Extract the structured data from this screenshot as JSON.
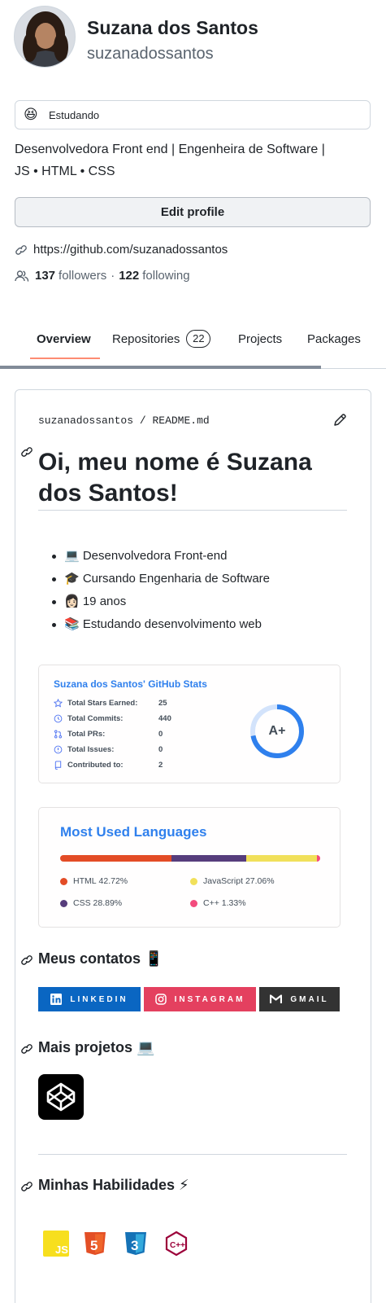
{
  "profile": {
    "name": "Suzana dos Santos",
    "login": "suzanadossantos",
    "status_emoji": "😆",
    "status_text": "Estudando",
    "bio_line1": "Desenvolvedora Front end | Engenheira de Software |",
    "bio_line2": "JS • HTML • CSS",
    "edit_button": "Edit profile",
    "link": "https://github.com/suzanadossantos",
    "followers_count": "137",
    "followers_label": "followers",
    "separator": "·",
    "following_count": "122",
    "following_label": "following"
  },
  "tabs": {
    "overview": "Overview",
    "repositories": "Repositories",
    "repositories_count": "22",
    "projects": "Projects",
    "packages": "Packages"
  },
  "readme": {
    "path_user": "suzanadossantos",
    "path_sep": "/",
    "path_file": "README.md",
    "heading_line1": "Oi, meu nome é Suzana",
    "heading_line2": "dos Santos!",
    "bullets": [
      "💻 Desenvolvedora Front-end",
      "🎓 Cursando Engenharia de Software",
      "👩🏻 19 anos",
      "📚 Estudando desenvolvimento web"
    ],
    "contacts_heading": "Meus contatos 📱",
    "projects_heading": "Mais projetos 💻",
    "skills_heading": "Minhas Habilidades ⚡"
  },
  "stats": {
    "title": "Suzana dos Santos' GitHub Stats",
    "rows": [
      {
        "label": "Total Stars Earned:",
        "value": "25",
        "icon": "star-icon"
      },
      {
        "label": "Total Commits:",
        "value": "440",
        "icon": "history-icon"
      },
      {
        "label": "Total PRs:",
        "value": "0",
        "icon": "pull-request-icon"
      },
      {
        "label": "Total Issues:",
        "value": "0",
        "icon": "issue-icon"
      },
      {
        "label": "Contributed to:",
        "value": "2",
        "icon": "repo-icon"
      }
    ],
    "grade": "A+",
    "grade_progress": 0.72,
    "accent": "#2f80ed"
  },
  "languages": {
    "title": "Most Used Languages",
    "items": [
      {
        "name": "HTML",
        "percent": "42.72%",
        "value": 42.72,
        "color": "#e34c26"
      },
      {
        "name": "CSS",
        "percent": "28.89%",
        "value": 28.89,
        "color": "#563d7c"
      },
      {
        "name": "JavaScript",
        "percent": "27.06%",
        "value": 27.06,
        "color": "#f1e05a"
      },
      {
        "name": "C++",
        "percent": "1.33%",
        "value": 1.33,
        "color": "#f34b7d"
      }
    ]
  },
  "badges": {
    "linkedin": "LINKEDIN",
    "instagram": "INSTAGRAM",
    "gmail": "GMAIL",
    "linkedin_color": "#0a66c2",
    "instagram_color": "#e4405f",
    "gmail_color": "#333333"
  },
  "skills": [
    {
      "label": "JS",
      "color": "#f7df1e"
    },
    {
      "label": "5",
      "color": "#e34f26"
    },
    {
      "label": "3",
      "color": "#1572b6"
    },
    {
      "label": "C++",
      "color": "#9c033a"
    }
  ]
}
